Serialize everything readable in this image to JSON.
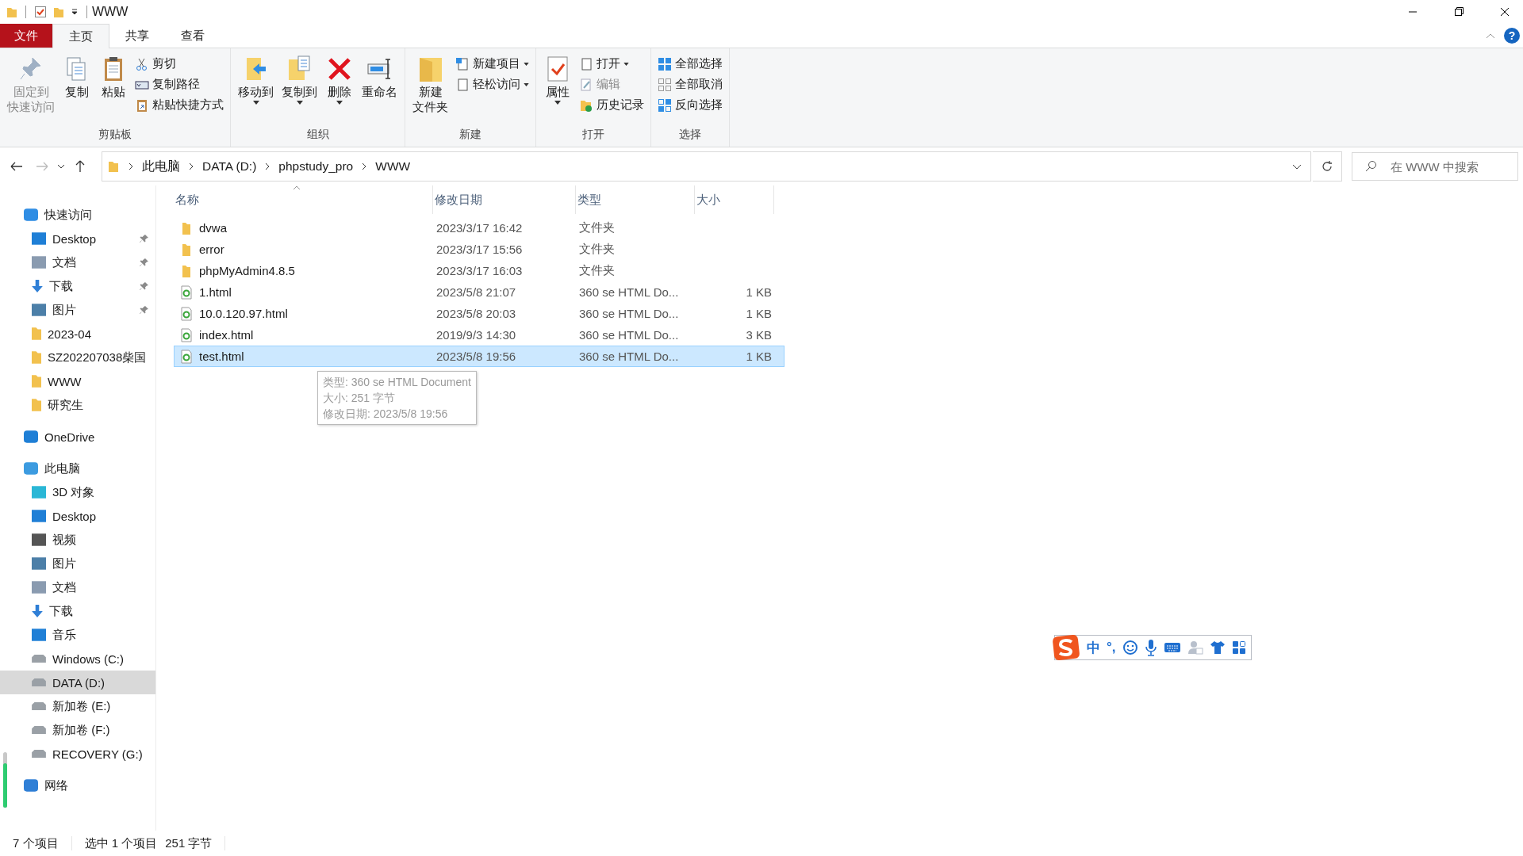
{
  "window": {
    "title": "WWW",
    "help": "?"
  },
  "ribbon_tabs": [
    {
      "label": "文件",
      "kind": "file",
      "selected": false
    },
    {
      "label": "主页",
      "kind": "tab",
      "selected": true
    },
    {
      "label": "共享",
      "kind": "tab",
      "selected": false
    },
    {
      "label": "查看",
      "kind": "tab",
      "selected": false
    }
  ],
  "ribbon_groups": [
    {
      "label": "剪贴板",
      "items": [
        {
          "kind": "large",
          "lines": [
            "固定到",
            "快速访问"
          ],
          "disabled": true,
          "dropdown": false
        },
        {
          "kind": "large",
          "lines": [
            "复制"
          ],
          "disabled": false,
          "dropdown": false
        },
        {
          "kind": "large",
          "lines": [
            "粘贴"
          ],
          "disabled": false,
          "dropdown": false
        },
        {
          "kind": "small",
          "lines": [
            "剪切"
          ],
          "disabled": false,
          "dropdown": false
        },
        {
          "kind": "small",
          "lines": [
            "复制路径"
          ],
          "disabled": false,
          "dropdown": false
        },
        {
          "kind": "small",
          "lines": [
            "粘贴快捷方式"
          ],
          "disabled": false,
          "dropdown": false
        }
      ]
    },
    {
      "label": "组织",
      "items": [
        {
          "kind": "large",
          "lines": [
            "移动到"
          ],
          "disabled": false,
          "dropdown": true
        },
        {
          "kind": "large",
          "lines": [
            "复制到"
          ],
          "disabled": false,
          "dropdown": true
        },
        {
          "kind": "large",
          "lines": [
            "删除"
          ],
          "disabled": false,
          "dropdown": true
        },
        {
          "kind": "large",
          "lines": [
            "重命名"
          ],
          "disabled": false,
          "dropdown": false
        }
      ]
    },
    {
      "label": "新建",
      "items": [
        {
          "kind": "large",
          "lines": [
            "新建",
            "文件夹"
          ],
          "disabled": false,
          "dropdown": false
        },
        {
          "kind": "small",
          "lines": [
            "新建项目"
          ],
          "disabled": false,
          "dropdown": true
        },
        {
          "kind": "small",
          "lines": [
            "轻松访问"
          ],
          "disabled": false,
          "dropdown": true
        }
      ]
    },
    {
      "label": "打开",
      "items": [
        {
          "kind": "large",
          "lines": [
            "属性"
          ],
          "disabled": false,
          "dropdown": true
        },
        {
          "kind": "small",
          "lines": [
            "打开"
          ],
          "disabled": false,
          "dropdown": true
        },
        {
          "kind": "small",
          "lines": [
            "编辑"
          ],
          "disabled": true,
          "dropdown": false
        },
        {
          "kind": "small",
          "lines": [
            "历史记录"
          ],
          "disabled": false,
          "dropdown": false
        }
      ]
    },
    {
      "label": "选择",
      "items": [
        {
          "kind": "small",
          "lines": [
            "全部选择"
          ],
          "disabled": false,
          "dropdown": false
        },
        {
          "kind": "small",
          "lines": [
            "全部取消"
          ],
          "disabled": false,
          "dropdown": false
        },
        {
          "kind": "small",
          "lines": [
            "反向选择"
          ],
          "disabled": false,
          "dropdown": false
        }
      ]
    }
  ],
  "address_bar": {
    "breadcrumbs": [
      "此电脑",
      "DATA (D:)",
      "phpstudy_pro",
      "WWW"
    ]
  },
  "search": {
    "placeholder": "在 WWW 中搜索"
  },
  "sidebar": {
    "sections": [
      {
        "label": "快速访问",
        "selected": false,
        "children": [
          {
            "label": "Desktop",
            "pinned": true,
            "selected": false
          },
          {
            "label": "文档",
            "pinned": true,
            "selected": false
          },
          {
            "label": "下载",
            "pinned": true,
            "selected": false
          },
          {
            "label": "图片",
            "pinned": true,
            "selected": false
          },
          {
            "label": "2023-04",
            "pinned": false,
            "selected": false
          },
          {
            "label": "SZ202207038柴国",
            "pinned": false,
            "selected": false
          },
          {
            "label": "WWW",
            "pinned": false,
            "selected": false
          },
          {
            "label": "研究生",
            "pinned": false,
            "selected": false
          }
        ]
      },
      {
        "label": "OneDrive",
        "selected": false
      },
      {
        "label": "此电脑",
        "selected": false,
        "children": [
          {
            "label": "3D 对象",
            "pinned": false,
            "selected": false
          },
          {
            "label": "Desktop",
            "pinned": false,
            "selected": false
          },
          {
            "label": "视频",
            "pinned": false,
            "selected": false
          },
          {
            "label": "图片",
            "pinned": false,
            "selected": false
          },
          {
            "label": "文档",
            "pinned": false,
            "selected": false
          },
          {
            "label": "下载",
            "pinned": false,
            "selected": false
          },
          {
            "label": "音乐",
            "pinned": false,
            "selected": false
          },
          {
            "label": "Windows (C:)",
            "pinned": false,
            "selected": false
          },
          {
            "label": "DATA (D:)",
            "pinned": false,
            "selected": true
          },
          {
            "label": "新加卷 (E:)",
            "pinned": false,
            "selected": false
          },
          {
            "label": "新加卷 (F:)",
            "pinned": false,
            "selected": false
          },
          {
            "label": "RECOVERY (G:)",
            "pinned": false,
            "selected": false
          }
        ]
      },
      {
        "label": "网络",
        "selected": false
      }
    ]
  },
  "table": {
    "columns": [
      "名称",
      "修改日期",
      "类型",
      "大小"
    ],
    "rows": [
      {
        "kind": "folder",
        "name": "dvwa",
        "date": "2023/3/17 16:42",
        "type": "文件夹",
        "selected": false
      },
      {
        "kind": "folder",
        "name": "error",
        "date": "2023/3/17 15:56",
        "type": "文件夹",
        "selected": false
      },
      {
        "kind": "folder",
        "name": "phpMyAdmin4.8.5",
        "date": "2023/3/17 16:03",
        "type": "文件夹",
        "selected": false
      },
      {
        "kind": "html",
        "name": "1.html",
        "date": "2023/5/8 21:07",
        "type": "360 se HTML Do...",
        "size": "1 KB",
        "selected": false
      },
      {
        "kind": "html",
        "name": "10.0.120.97.html",
        "date": "2023/5/8 20:03",
        "type": "360 se HTML Do...",
        "size": "1 KB",
        "selected": false
      },
      {
        "kind": "html",
        "name": "index.html",
        "date": "2019/9/3 14:30",
        "type": "360 se HTML Do...",
        "size": "3 KB",
        "selected": false
      },
      {
        "kind": "html",
        "name": "test.html",
        "date": "2023/5/8 19:56",
        "type": "360 se HTML Do...",
        "size": "1 KB",
        "selected": true
      }
    ]
  },
  "tooltip": [
    "类型: 360 se HTML Document",
    "大小: 251 字节",
    "修改日期: 2023/5/8 19:56"
  ],
  "ime_toolbar": {
    "mode": "中",
    "punctuation": "°,"
  },
  "status_bar": {
    "item_count": "7 个项目",
    "selection": "选中 1 个项目",
    "selection_size": "251 字节"
  }
}
